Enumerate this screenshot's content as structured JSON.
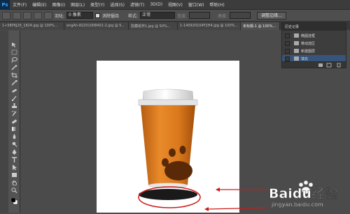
{
  "app": {
    "logo": "Ps"
  },
  "menus": [
    "文件(F)",
    "编辑(E)",
    "图像(I)",
    "图层(L)",
    "类型(Y)",
    "选择(S)",
    "滤镜(T)",
    "3D(D)",
    "视图(V)",
    "窗口(W)",
    "帮助(H)"
  ],
  "options": {
    "feather_label": "羽化:",
    "feather_value": "0 像素",
    "antialias_label": "消除锯齿",
    "style_label": "样式:",
    "style_value": "正常",
    "width_label": "宽度:",
    "height_label": "高度:",
    "refine_button": "调整边缘..."
  },
  "tabs": [
    "1+58P6J26_1824.jpg @ 100%...",
    "engAh-82201008401-2.jpg @ 5...",
    "隐藏纸杯1.jpg @ 50%...",
    "1-140920104F2H4.jpg @ 100%...",
    "未标题-1 @ 100%..."
  ],
  "history": {
    "title": "历史记录",
    "items": [
      "椭圆选框",
      "移动选区",
      "新建图层",
      "填充"
    ],
    "selected_index": 3
  },
  "watermark": {
    "brand": "Baidu经验",
    "url": "jingyan.baidu.com"
  },
  "icons": {
    "tools": [
      "move-icon",
      "marquee-icon",
      "lasso-icon",
      "quick-select-icon",
      "crop-icon",
      "eyedropper-icon",
      "heal-icon",
      "brush-icon",
      "stamp-icon",
      "history-brush-icon",
      "eraser-icon",
      "gradient-icon",
      "blur-icon",
      "dodge-icon",
      "pen-icon",
      "type-icon",
      "path-select-icon",
      "shape-icon",
      "hand-icon",
      "zoom-icon"
    ]
  },
  "colors": {
    "cup_orange": "#d97a1e",
    "annotation_red": "#cc1a1a",
    "history_selected": "#37557a"
  }
}
